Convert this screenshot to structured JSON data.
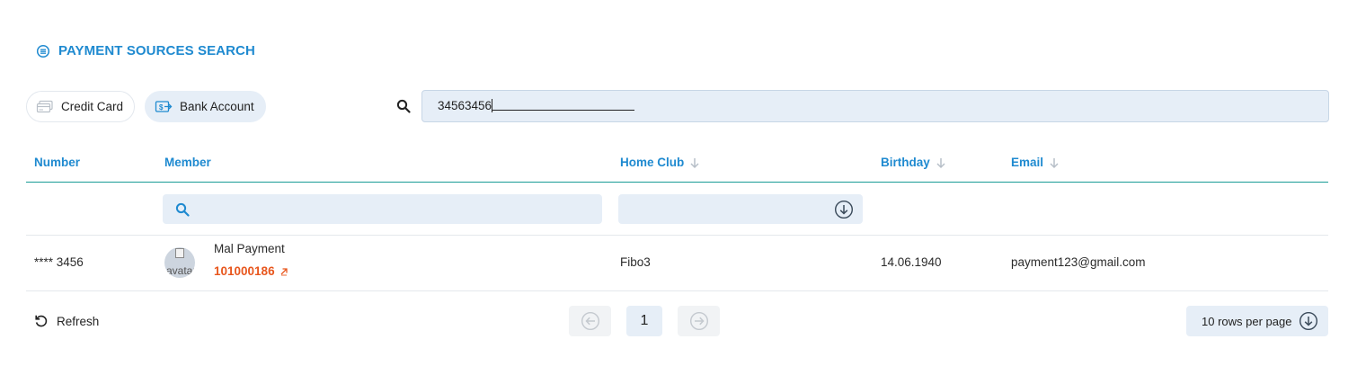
{
  "page": {
    "title": "PAYMENT SOURCES SEARCH",
    "title_icon": "list-circle-icon"
  },
  "source_types": [
    {
      "label": "Credit Card",
      "icon": "credit-card-icon",
      "active": false
    },
    {
      "label": "Bank Account",
      "icon": "bank-transfer-icon",
      "active": true
    }
  ],
  "search": {
    "value": "34563456",
    "icon": "search-icon"
  },
  "table": {
    "columns": [
      {
        "label": "Number",
        "sortable": false
      },
      {
        "label": "Member",
        "sortable": false
      },
      {
        "label": "Home Club",
        "sortable": true
      },
      {
        "label": "Birthday",
        "sortable": true
      },
      {
        "label": "Email",
        "sortable": true
      }
    ],
    "filters": {
      "member_placeholder": "",
      "home_club_value": ""
    },
    "rows": [
      {
        "number": "**** 3456",
        "avatar_alt": "avatar",
        "member_name": "Mal Payment",
        "member_id": "101000186",
        "home_club": "Fibo3",
        "birthday": "14.06.1940",
        "email": "payment123@gmail.com"
      }
    ]
  },
  "footer": {
    "refresh_label": "Refresh",
    "current_page": "1",
    "rows_per_page": "10 rows per page"
  },
  "colors": {
    "accent": "#1f8ad0",
    "member_id": "#e8571e",
    "header_line": "#1a9c96",
    "field_bg": "#e6eef7"
  }
}
